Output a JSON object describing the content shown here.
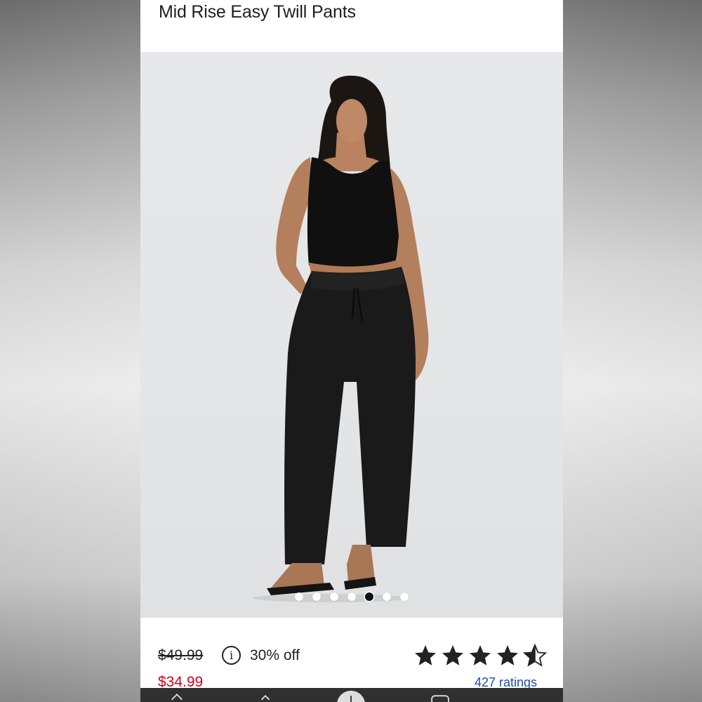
{
  "product": {
    "title": "Mid Rise Easy Twill Pants"
  },
  "gallery": {
    "image_count": 7,
    "active_index": 4
  },
  "pricing": {
    "original_price": "$49.99",
    "discount_label": "30% off",
    "sale_price": "$34.99",
    "info_icon": "info-icon"
  },
  "rating": {
    "stars_filled": 4.5,
    "stars_total": 5,
    "ratings_label": "427 ratings"
  },
  "colors": {
    "sale_price": "#d0021b",
    "link": "#1b4fa3",
    "star": "#222222",
    "bottom_bar": "#303030"
  },
  "bottom_nav": {
    "icons": [
      "home-icon",
      "back-icon",
      "add-icon",
      "tabs-icon"
    ]
  }
}
